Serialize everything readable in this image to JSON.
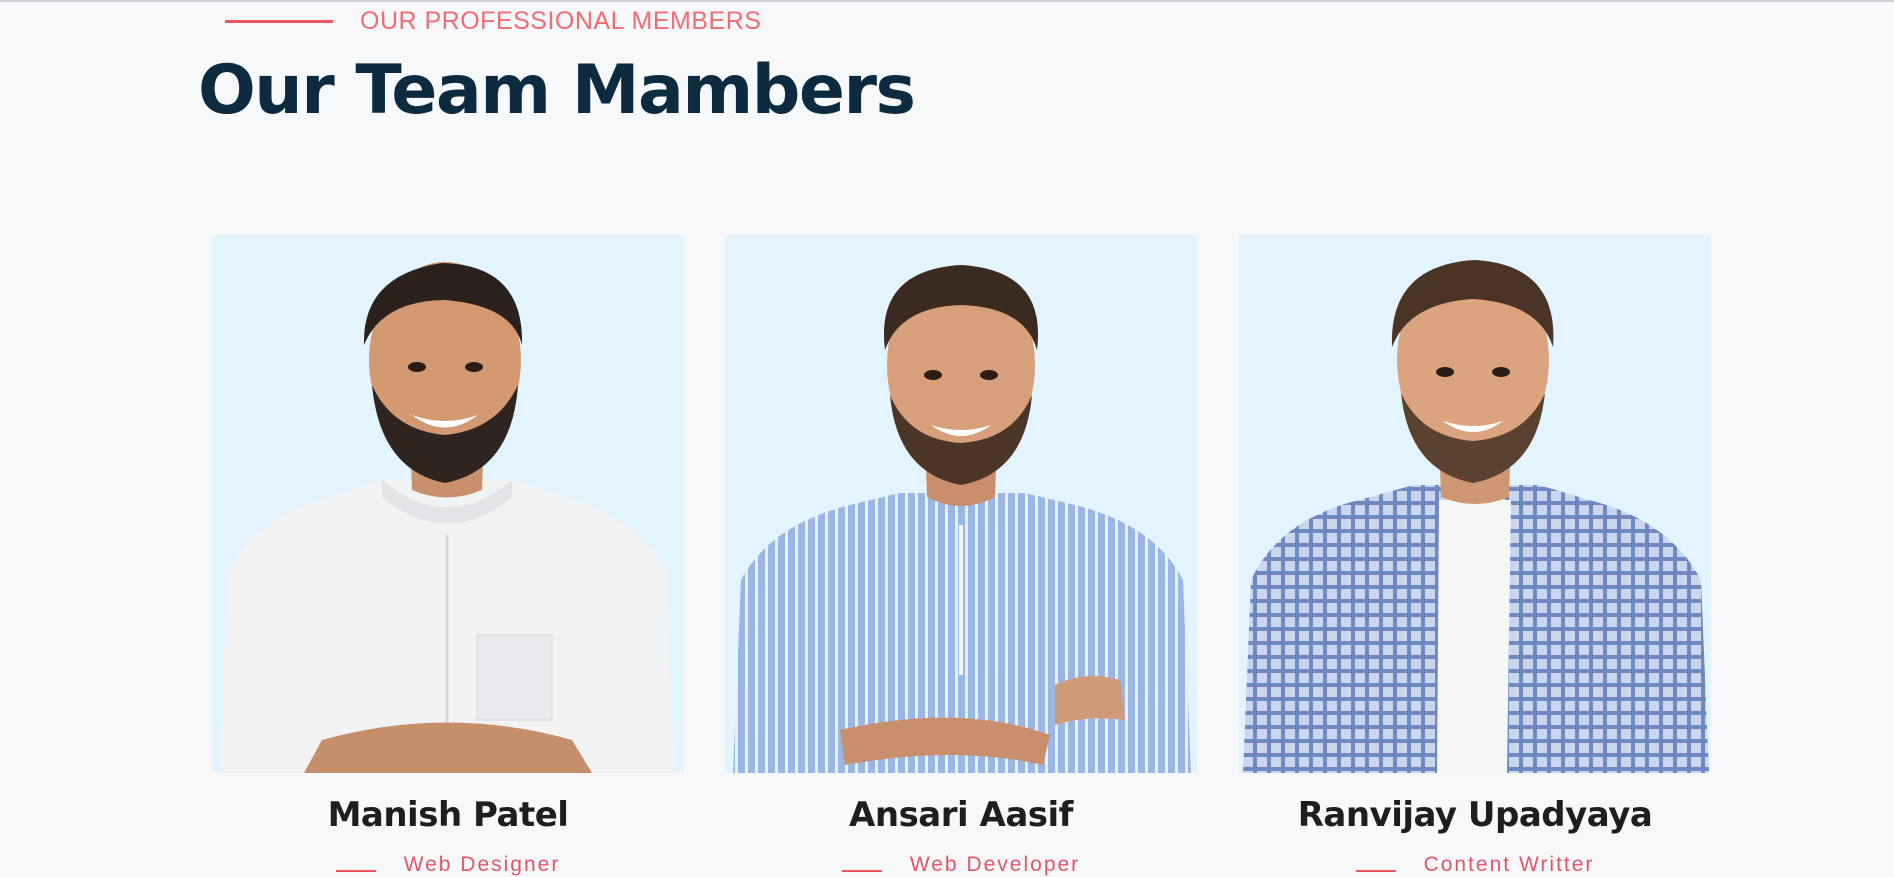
{
  "section": {
    "eyebrow": "OUR PROFESSIONAL MEMBERS",
    "title": "Our Team Mambers"
  },
  "team": [
    {
      "name": "Manish Patel",
      "role": "Web Designer",
      "shirt": "white-shirt"
    },
    {
      "name": "Ansari Aasif",
      "role": "Web Developer",
      "shirt": "blue-striped-shirt"
    },
    {
      "name": "Ranvijay Upadyaya",
      "role": "Content Writter",
      "shirt": "blue-checked-shirt"
    }
  ],
  "colors": {
    "accent": "#f0545c",
    "title": "#0c2b40",
    "photo_bg": "#e4f4fe",
    "page_bg": "#f7f8fa"
  }
}
